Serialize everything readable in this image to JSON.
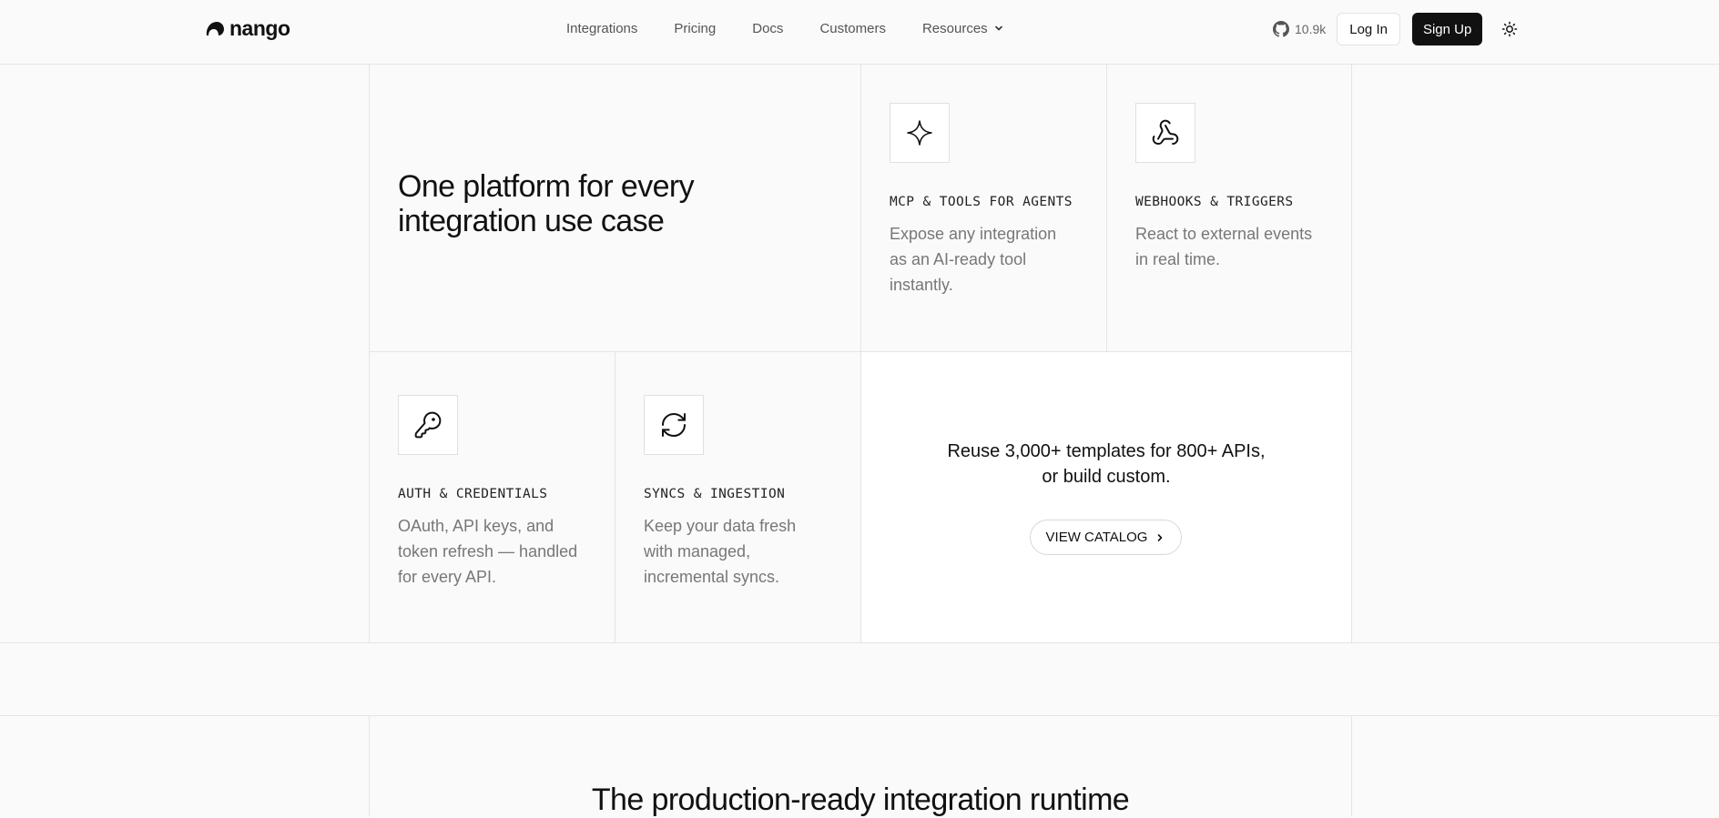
{
  "nav": {
    "brand": "nango",
    "links": [
      {
        "label": "Integrations"
      },
      {
        "label": "Pricing"
      },
      {
        "label": "Docs"
      },
      {
        "label": "Customers"
      },
      {
        "label": "Resources",
        "icon": "chevron-down-icon"
      }
    ],
    "github_stars": "10.9k",
    "login_label": "Log In",
    "signup_label": "Sign Up",
    "theme_icon": "sun-icon"
  },
  "hero": {
    "headline": "One platform for every integration use case"
  },
  "cards": [
    {
      "icon": "sparkle-icon",
      "title": "MCP & TOOLS FOR AGENTS",
      "description": "Expose any integration as an AI-ready tool instantly."
    },
    {
      "icon": "webhook-icon",
      "title": "WEBHOOKS & TRIGGERS",
      "description": "React to external events in real time."
    },
    {
      "icon": "key-icon",
      "title": "AUTH & CREDENTIALS",
      "description": "OAuth, API keys, and token refresh — handled for every API."
    },
    {
      "icon": "refresh-icon",
      "title": "SYNCS & INGESTION",
      "description": "Keep your data fresh with managed, incremental syncs."
    }
  ],
  "catalog": {
    "line1": "Reuse 3,000+ templates for 800+ APIs,",
    "line2": "or build custom.",
    "button_label": "VIEW CATALOG"
  },
  "next_section": {
    "heading": "The production-ready integration runtime"
  },
  "colors": {
    "background": "#fafafa",
    "border": "#e5e5e5",
    "primary_button": "#111111",
    "muted_text": "#777777"
  }
}
